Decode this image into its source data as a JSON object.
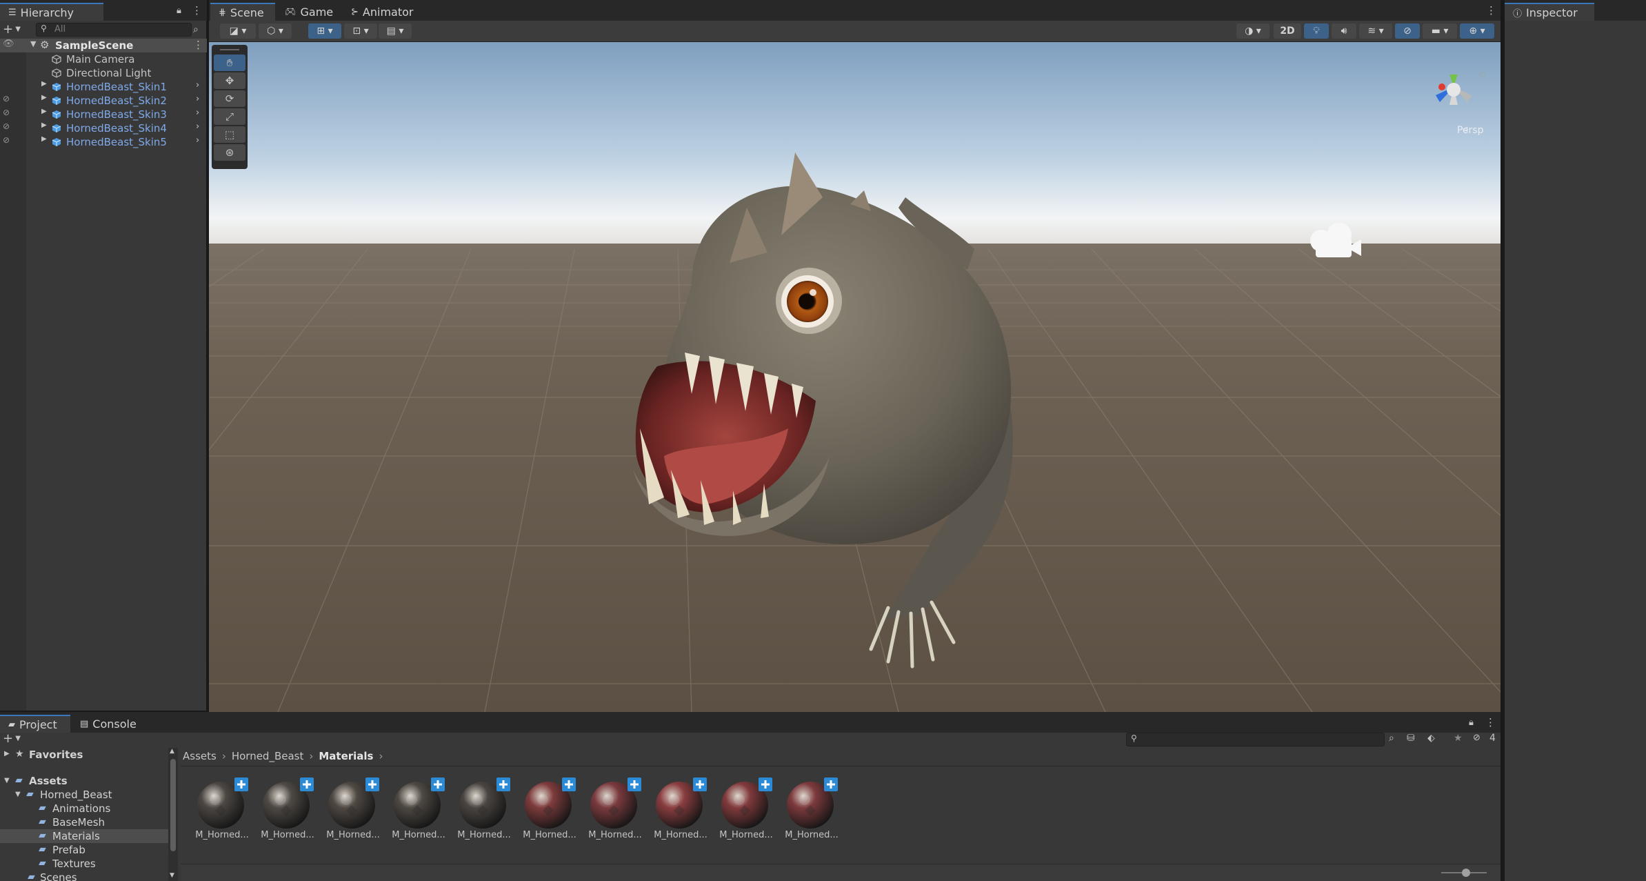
{
  "hierarchy": {
    "tab_label": "Hierarchy",
    "search_placeholder": "All",
    "scene_name": "SampleScene",
    "items": [
      {
        "label": "Main Camera"
      },
      {
        "label": "Directional Light"
      },
      {
        "label": "HornedBeast_Skin1"
      },
      {
        "label": "HornedBeast_Skin2"
      },
      {
        "label": "HornedBeast_Skin3"
      },
      {
        "label": "HornedBeast_Skin4"
      },
      {
        "label": "HornedBeast_Skin5"
      }
    ]
  },
  "scene": {
    "tabs": [
      {
        "label": "Scene"
      },
      {
        "label": "Game"
      },
      {
        "label": "Animator"
      }
    ],
    "toolbar": {
      "mode_2d": "2D"
    },
    "gizmo_label": "Persp"
  },
  "inspector": {
    "tab_label": "Inspector"
  },
  "project": {
    "tabs": [
      {
        "label": "Project"
      },
      {
        "label": "Console"
      }
    ],
    "favorites_label": "Favorites",
    "assets_label": "Assets",
    "tree": [
      {
        "label": "Horned_Beast"
      },
      {
        "label": "Animations"
      },
      {
        "label": "BaseMesh"
      },
      {
        "label": "Materials"
      },
      {
        "label": "Prefab"
      },
      {
        "label": "Textures"
      },
      {
        "label": "Scenes"
      }
    ],
    "breadcrumb": [
      "Assets",
      "Horned_Beast",
      "Materials"
    ],
    "hidden_count": "4",
    "materials": [
      {
        "label": "M_Horned...",
        "tint": "#4c4743"
      },
      {
        "label": "M_Horned...",
        "tint": "#4e4944"
      },
      {
        "label": "M_Horned...",
        "tint": "#4f4843"
      },
      {
        "label": "M_Horned...",
        "tint": "#4d4842"
      },
      {
        "label": "M_Horned...",
        "tint": "#4a4541"
      },
      {
        "label": "M_Horned...",
        "tint": "#7e3b3c"
      },
      {
        "label": "M_Horned...",
        "tint": "#7a3a3e"
      },
      {
        "label": "M_Horned...",
        "tint": "#8a3d3f"
      },
      {
        "label": "M_Horned...",
        "tint": "#813a3c"
      },
      {
        "label": "M_Horned...",
        "tint": "#7d3a3d"
      }
    ]
  },
  "colors": {
    "selection": "#2c5d87",
    "accent": "#3a79bb",
    "prefab_text": "#7fa9e8"
  }
}
